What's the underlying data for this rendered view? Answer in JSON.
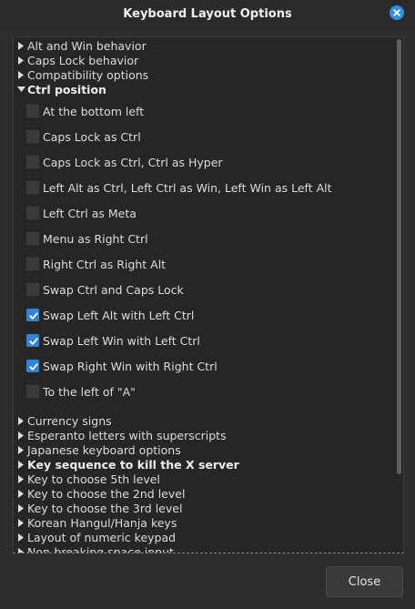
{
  "window": {
    "title": "Keyboard Layout Options",
    "accent": "#2f84d8"
  },
  "tree": {
    "groups_top": [
      {
        "label": "Alt and Win behavior",
        "expanded": false,
        "bold": false
      },
      {
        "label": "Caps Lock behavior",
        "expanded": false,
        "bold": false
      },
      {
        "label": "Compatibility options",
        "expanded": false,
        "bold": false
      },
      {
        "label": "Ctrl position",
        "expanded": true,
        "bold": true
      }
    ],
    "ctrl_options": [
      {
        "label": "At the bottom left",
        "checked": false
      },
      {
        "label": "Caps Lock as Ctrl",
        "checked": false
      },
      {
        "label": "Caps Lock as Ctrl, Ctrl as Hyper",
        "checked": false
      },
      {
        "label": "Left Alt as Ctrl, Left Ctrl as Win, Left Win as Left Alt",
        "checked": false
      },
      {
        "label": "Left Ctrl as Meta",
        "checked": false
      },
      {
        "label": "Menu as Right Ctrl",
        "checked": false
      },
      {
        "label": "Right Ctrl as Right Alt",
        "checked": false
      },
      {
        "label": "Swap Ctrl and Caps Lock",
        "checked": false
      },
      {
        "label": "Swap Left Alt with Left Ctrl",
        "checked": true
      },
      {
        "label": "Swap Left Win with Left Ctrl",
        "checked": true
      },
      {
        "label": "Swap Right Win with Right Ctrl",
        "checked": true
      },
      {
        "label": "To the left of \"A\"",
        "checked": false
      }
    ],
    "groups_bottom": [
      {
        "label": "Currency signs",
        "expanded": false,
        "bold": false
      },
      {
        "label": "Esperanto letters with superscripts",
        "expanded": false,
        "bold": false
      },
      {
        "label": "Japanese keyboard options",
        "expanded": false,
        "bold": false
      },
      {
        "label": "Key sequence to kill the X server",
        "expanded": false,
        "bold": true
      },
      {
        "label": "Key to choose 5th level",
        "expanded": false,
        "bold": false
      },
      {
        "label": "Key to choose the 2nd level",
        "expanded": false,
        "bold": false
      },
      {
        "label": "Key to choose the 3rd level",
        "expanded": false,
        "bold": false
      },
      {
        "label": "Korean Hangul/Hanja keys",
        "expanded": false,
        "bold": false
      },
      {
        "label": "Layout of numeric keypad",
        "expanded": false,
        "bold": false
      },
      {
        "label": "Non-breaking space input",
        "expanded": false,
        "bold": false
      }
    ]
  },
  "footer": {
    "close_label": "Close"
  }
}
